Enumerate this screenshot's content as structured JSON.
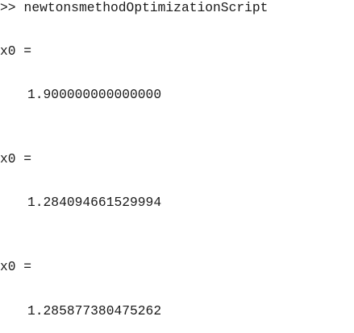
{
  "console": {
    "prompt_symbol": ">>",
    "command": "newtonsmethodOptimizationScript",
    "outputs": [
      {
        "label": "x0 =",
        "value": "1.900000000000000"
      },
      {
        "label": "x0 =",
        "value": "1.284094661529994"
      },
      {
        "label": "x0 =",
        "value": "1.285877380475262"
      }
    ]
  }
}
